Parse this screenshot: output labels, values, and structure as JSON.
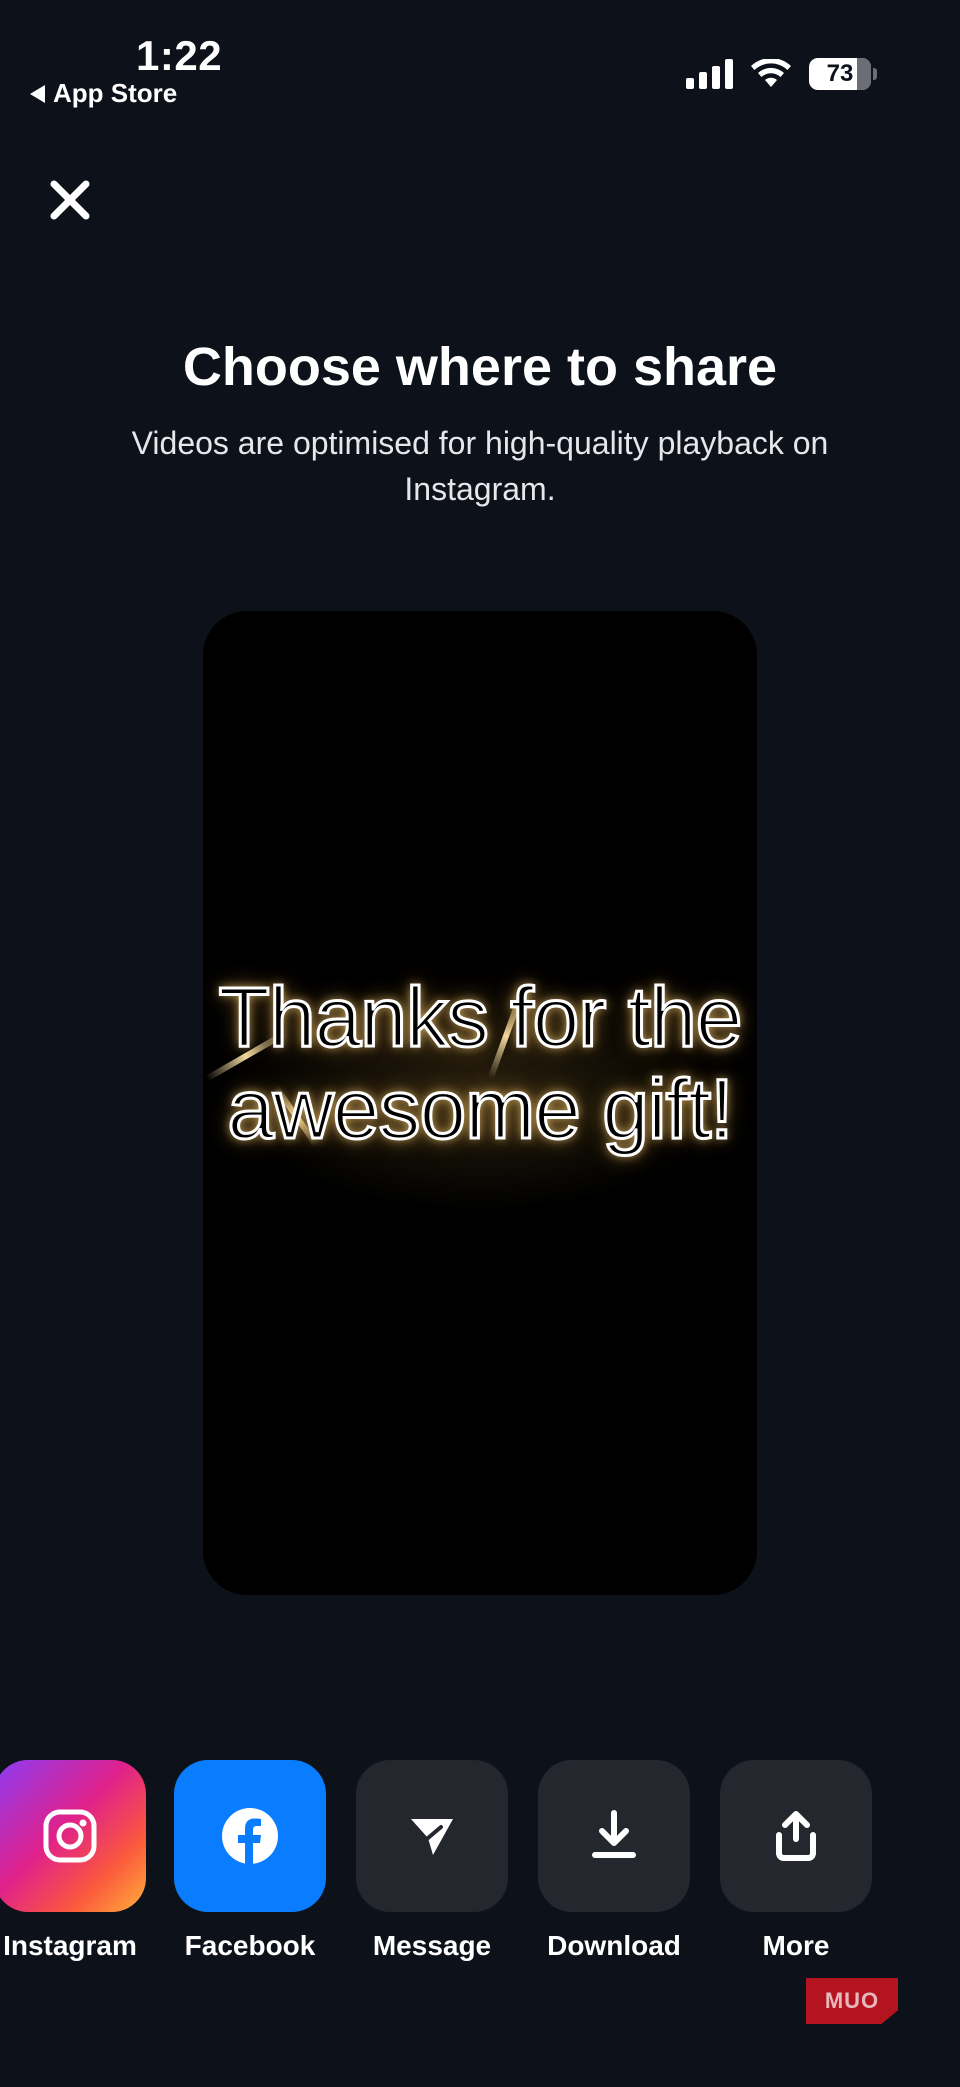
{
  "status_bar": {
    "time": "1:22",
    "back_app": "App Store",
    "battery_level": "73"
  },
  "header": {
    "title": "Choose where to share",
    "subtitle": "Videos are optimised for high-quality playback on Instagram."
  },
  "preview": {
    "text": "Thanks for the awesome gift!"
  },
  "share_options": [
    {
      "label": "Instagram",
      "icon": "instagram-icon"
    },
    {
      "label": "Facebook",
      "icon": "facebook-icon"
    },
    {
      "label": "Message",
      "icon": "send-icon"
    },
    {
      "label": "Download",
      "icon": "download-icon"
    },
    {
      "label": "More",
      "icon": "share-up-icon"
    }
  ],
  "watermark": "MUO",
  "colors": {
    "background": "#0d111a",
    "facebook_blue": "#0a7cff",
    "tile_dark": "#24272e",
    "watermark_red": "#b3141f"
  }
}
